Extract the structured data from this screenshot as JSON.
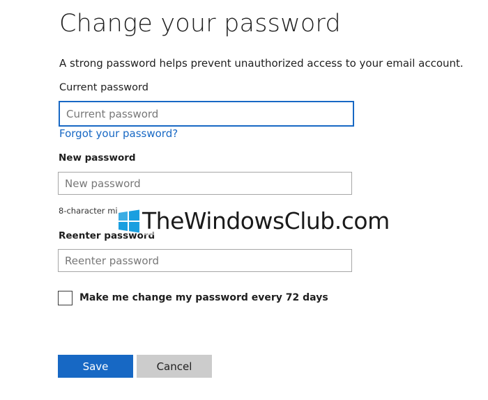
{
  "page": {
    "title": "Change your password",
    "description": "A strong password helps prevent unauthorized access to your email account."
  },
  "form": {
    "current_password": {
      "label": "Current password",
      "placeholder": "Current password",
      "value": ""
    },
    "forgot_link": "Forgot your password?",
    "new_password": {
      "label": "New password",
      "placeholder": "New password",
      "value": "",
      "hint": "8-character mi"
    },
    "reenter_password": {
      "label": "Reenter password",
      "placeholder": "Reenter password",
      "value": ""
    },
    "expire_checkbox": {
      "label": "Make me change my password every 72 days",
      "checked": false
    }
  },
  "buttons": {
    "save": "Save",
    "cancel": "Cancel"
  },
  "watermark": {
    "text": "TheWindowsClub.com",
    "icon": "windows-logo-icon"
  },
  "colors": {
    "accent": "#1768c4",
    "secondary_button": "#cccccc",
    "field_border": "#a6a6a6"
  }
}
